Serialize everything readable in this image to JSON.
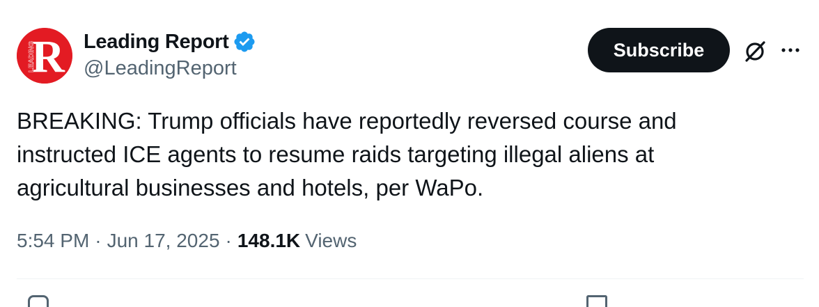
{
  "author": {
    "display_name": "Leading Report",
    "handle": "@LeadingReport",
    "verified": true,
    "avatar_icon": "leading-report-logo",
    "avatar_color": "#e31b23",
    "avatar_letter": "R",
    "avatar_side_text": "LEADING"
  },
  "actions": {
    "subscribe_label": "Subscribe",
    "grok_icon": "grok-icon",
    "more_icon": "more-icon"
  },
  "tweet": {
    "text": "BREAKING: Trump officials have reportedly reversed course and instructed ICE agents to resume raids targeting illegal aliens at agricultural businesses and hotels, per WaPo.",
    "time": "5:54 PM",
    "date": "Jun 17, 2025",
    "separator": "·",
    "views_count": "148.1K",
    "views_label": "Views"
  },
  "colors": {
    "text_primary": "#0f1419",
    "text_secondary": "#536471",
    "verified_blue": "#1d9bf0",
    "button_bg": "#0f1419"
  }
}
